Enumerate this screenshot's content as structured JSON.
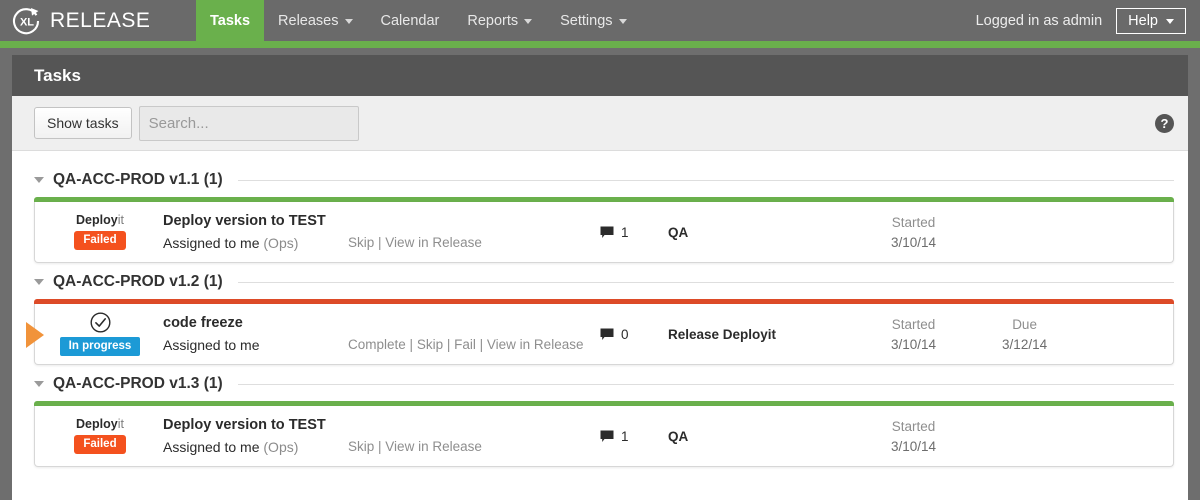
{
  "nav": {
    "brand": "RELEASE",
    "brand_icon": "xl-circular-arrow-logo",
    "items": [
      {
        "label": "Tasks",
        "active": true,
        "dropdown": false
      },
      {
        "label": "Releases",
        "active": false,
        "dropdown": true
      },
      {
        "label": "Calendar",
        "active": false,
        "dropdown": false
      },
      {
        "label": "Reports",
        "active": false,
        "dropdown": true
      },
      {
        "label": "Settings",
        "active": false,
        "dropdown": true
      }
    ],
    "logged_in": "Logged in as admin",
    "help_label": "Help",
    "accent_color": "#6ab04c",
    "bar_color": "#6a6a6a"
  },
  "page": {
    "title": "Tasks",
    "title_bar_color": "#555555"
  },
  "toolbar": {
    "show_tasks_label": "Show tasks",
    "search_placeholder": "Search...",
    "search_value": "",
    "help_icon_glyph": "?"
  },
  "groups": [
    {
      "name": "QA-ACC-PROD v1.1 (1)",
      "expanded": true,
      "tasks": [
        {
          "accent": "#6ab04c",
          "accent_state": "ok",
          "pointer": false,
          "status_kind": "deployit-logo",
          "status_logo_bold": "Deploy",
          "status_logo_light": "it",
          "badge_label": "Failed",
          "badge_kind": "failed",
          "badge_color": "#f4511e",
          "title": "Deploy version to TEST",
          "assignee": "Assigned to me",
          "team": "(Ops)",
          "actions": [
            "Skip",
            "View in Release"
          ],
          "comment_count": "1",
          "release": "QA",
          "dates": [
            {
              "label": "Started",
              "value": "3/10/14"
            }
          ]
        }
      ]
    },
    {
      "name": "QA-ACC-PROD v1.2 (1)",
      "expanded": true,
      "tasks": [
        {
          "accent": "#dd4b28",
          "accent_state": "busy",
          "pointer": true,
          "pointer_color": "#f1933a",
          "status_kind": "check-circle-icon",
          "badge_label": "In progress",
          "badge_kind": "progress",
          "badge_color": "#1c9ad6",
          "title": "code freeze",
          "assignee": "Assigned to me",
          "team": "",
          "actions": [
            "Complete",
            "Skip",
            "Fail",
            "View in Release"
          ],
          "comment_count": "0",
          "release": "Release Deployit",
          "dates": [
            {
              "label": "Started",
              "value": "3/10/14"
            },
            {
              "label": "Due",
              "value": "3/12/14"
            }
          ]
        }
      ]
    },
    {
      "name": "QA-ACC-PROD v1.3 (1)",
      "expanded": true,
      "tasks": [
        {
          "accent": "#6ab04c",
          "accent_state": "ok",
          "pointer": false,
          "status_kind": "deployit-logo",
          "status_logo_bold": "Deploy",
          "status_logo_light": "it",
          "badge_label": "Failed",
          "badge_kind": "failed",
          "badge_color": "#f4511e",
          "title": "Deploy version to TEST",
          "assignee": "Assigned to me",
          "team": "(Ops)",
          "actions": [
            "Skip",
            "View in Release"
          ],
          "comment_count": "1",
          "release": "QA",
          "dates": [
            {
              "label": "Started",
              "value": "3/10/14"
            }
          ]
        }
      ]
    }
  ]
}
